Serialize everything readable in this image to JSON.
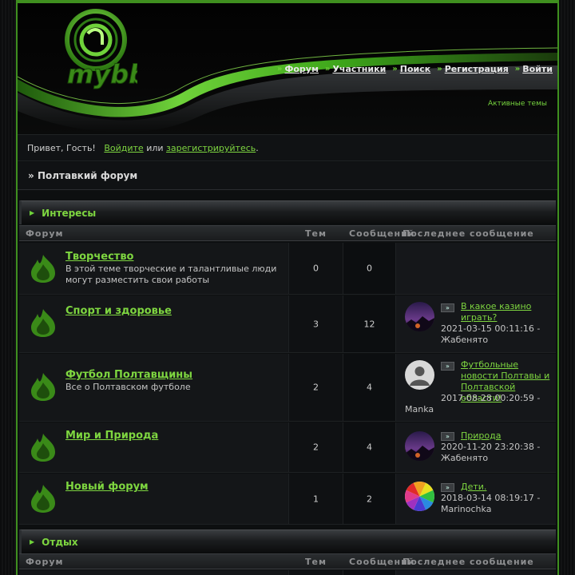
{
  "header": {
    "nav": [
      {
        "label": "Форум"
      },
      {
        "label": "Участники"
      },
      {
        "label": "Поиск"
      },
      {
        "label": "Регистрация"
      },
      {
        "label": "Войти"
      }
    ],
    "active_topics": "Активные темы"
  },
  "welcome": {
    "greeting": "Привет, Гость!",
    "login_link": "Войдите",
    "or": "или",
    "register_link": "зарегистрируйтесь",
    "end": "."
  },
  "breadcrumb": {
    "prefix": "»",
    "title": "Полтавкий форум"
  },
  "columns": {
    "forum": "Форум",
    "topics": "Тем",
    "posts": "Сообщений",
    "last": "Последнее сообщение"
  },
  "categories": [
    {
      "title": "Интересы",
      "forums": [
        {
          "name": "Творчество",
          "desc": "В этой теме творческие и талантливые люди могут разместить свои работы",
          "topics": "0",
          "posts": "0"
        },
        {
          "name": "Спорт и здоровье",
          "desc": "",
          "topics": "3",
          "posts": "12",
          "last_title": "В какое казино играть?",
          "last_date": "2021-03-15 00:11:16 -",
          "last_user": "Жабенято",
          "avatar": "night-landscape-avatar"
        },
        {
          "name": "Футбол Полтавщины",
          "desc": "Все о Полтавском футболе",
          "topics": "2",
          "posts": "4",
          "last_title": "Футбольные новости Полтавы и Полтавской области!",
          "last_date": "2017-08-28 00:20:59 -",
          "last_user": "Manka",
          "avatar": "default-user-avatar"
        },
        {
          "name": "Мир и Природа",
          "desc": "",
          "topics": "2",
          "posts": "4",
          "last_title": "Природа",
          "last_date": "2020-11-20 23:20:38 -",
          "last_user": "Жабенято",
          "avatar": "night-landscape-avatar"
        },
        {
          "name": "Новый форум",
          "desc": "",
          "topics": "1",
          "posts": "2",
          "last_title": "Дети.",
          "last_date": "2018-03-14 08:19:17 -",
          "last_user": "Marinochka",
          "avatar": "umbrella-avatar"
        }
      ]
    },
    {
      "title": "Отдых",
      "forums": []
    }
  ],
  "colors": {
    "accent": "#7ed640",
    "frame": "#3f8f1f",
    "background": "#0d0f10"
  }
}
